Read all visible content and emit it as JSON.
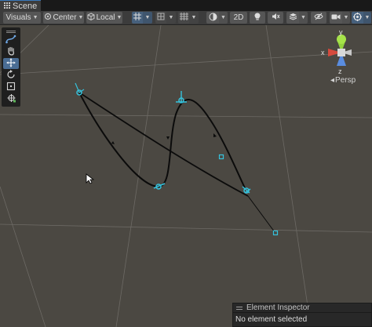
{
  "tab": {
    "title": "Scene",
    "icon": "grid-menu-icon"
  },
  "toolbar": {
    "visuals_label": "Visuals",
    "pivot_label": "Center",
    "space_label": "Local",
    "twod_label": "2D",
    "icons": [
      "grid-snap-icon",
      "snap-increment-icon",
      "grid-toggle-icon",
      "shading-mode-icon",
      "lighting-icon",
      "audio-icon",
      "effects-icon",
      "scene-visibility-icon",
      "camera-icon",
      "gizmos-icon"
    ]
  },
  "palette": {
    "tools": [
      "spline-create-tool",
      "hand-tool",
      "move-tool",
      "rotate-tool",
      "rect-tool",
      "transform-tool"
    ],
    "selected": "move-tool"
  },
  "gizmo": {
    "labels": {
      "x": "x",
      "y": "y",
      "z": "z"
    },
    "projection": "Persp"
  },
  "inspector": {
    "title": "Element Inspector",
    "status": "No element selected"
  },
  "colors": {
    "viewport": "#4b4842",
    "spline": "#0b0b0b",
    "knot": "#35c2dc",
    "gizmo_x": "#d44a3d",
    "gizmo_y": "#92d23e",
    "gizmo_z": "#5a8de0",
    "selected_tool": "#4a6d94"
  }
}
